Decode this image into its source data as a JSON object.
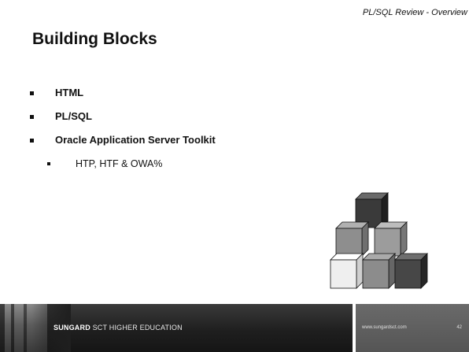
{
  "header": {
    "subtitle": "PL/SQL  Review - Overview"
  },
  "slide": {
    "title": "Building Blocks",
    "bullets": [
      "HTML",
      "PL/SQL",
      "Oracle Application Server Toolkit"
    ],
    "sub_bullets": [
      "HTP, HTF & OWA%"
    ]
  },
  "illustration": {
    "name": "stacked blocks",
    "colors": {
      "dark": "#3a3a3a",
      "mid": "#8e8e8e",
      "light": "#ececec"
    }
  },
  "footer": {
    "brand_bold": "SUNGARD",
    "brand_rest": " SCT HIGHER EDUCATION",
    "url": "www.sungardsct.com",
    "page_number": "42"
  }
}
